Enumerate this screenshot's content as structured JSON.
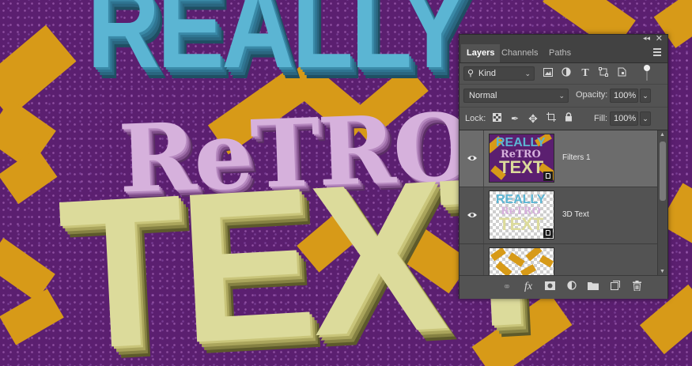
{
  "artwork": {
    "word1": "REALLY",
    "word2": "ReTRO",
    "word3": "TEXT",
    "colors": {
      "background": "#5b1f70",
      "zigzag": "#d79a18",
      "really": "#5bb5d3",
      "retro": "#d6b1dc",
      "text": "#dcdb9b"
    }
  },
  "panel": {
    "tabs": [
      {
        "label": "Layers",
        "active": true
      },
      {
        "label": "Channels",
        "active": false
      },
      {
        "label": "Paths",
        "active": false
      }
    ],
    "filter": {
      "kind_label": "Kind",
      "icons": [
        "image-filter-icon",
        "adjustment-filter-icon",
        "type-filter-icon",
        "shape-filter-icon",
        "smart-object-filter-icon"
      ]
    },
    "blend_mode": "Normal",
    "opacity_label": "Opacity:",
    "opacity_value": "100%",
    "lock_label": "Lock:",
    "fill_label": "Fill:",
    "fill_value": "100%",
    "layers": [
      {
        "name": "Filters 1",
        "visible": true,
        "selected": true,
        "thumb_line1": "REALLY",
        "thumb_line2": "ReTRO",
        "thumb_line3": "TEXT"
      },
      {
        "name": "3D Text",
        "visible": true,
        "selected": false,
        "thumb_line1": "REALLY",
        "thumb_line2": "ReTRO",
        "thumb_line3": "TEXT"
      },
      {
        "name": "",
        "visible": false,
        "selected": false
      }
    ],
    "footer_icons": [
      "link-layers-icon",
      "fx-icon",
      "layer-mask-icon",
      "adjustment-layer-icon",
      "new-group-icon",
      "new-layer-icon",
      "delete-layer-icon"
    ]
  }
}
